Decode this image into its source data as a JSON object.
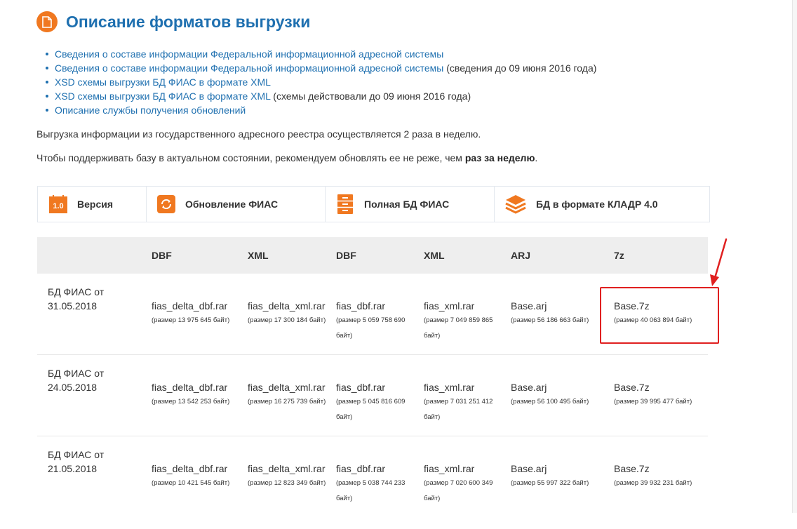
{
  "page": {
    "title": "Описание форматов выгрузки"
  },
  "links": [
    {
      "text": "Сведения о составе информации Федеральной информационной адресной системы",
      "note": ""
    },
    {
      "text": "Сведения о составе информации Федеральной информационной адресной системы",
      "note": " (сведения до 09 июня 2016 года)"
    },
    {
      "text": "XSD схемы выгрузки БД ФИАС в формате XML",
      "note": ""
    },
    {
      "text": "XSD схемы выгрузки БД ФИАС в формате XML",
      "note": " (схемы действовали до 09 июня 2016 года)"
    },
    {
      "text": "Описание службы получения обновлений",
      "note": ""
    }
  ],
  "paragraphs": {
    "schedule": "Выгрузка информации из государственного адресного реестра осуществляется 2 раза в неделю.",
    "recommend_prefix": "Чтобы поддерживать базу в актуальном состоянии, рекомендуем обновлять ее не реже, чем ",
    "recommend_bold": "раз за неделю",
    "recommend_suffix": "."
  },
  "tabs": [
    {
      "label": "Версия",
      "icon": "version-icon",
      "icon_text": "1.0"
    },
    {
      "label": "Обновление ФИАС",
      "icon": "refresh-icon"
    },
    {
      "label": "Полная БД ФИАС",
      "icon": "cabinet-icon"
    },
    {
      "label": "БД в формате КЛАДР 4.0",
      "icon": "layers-icon"
    }
  ],
  "table": {
    "columns": [
      "DBF",
      "XML",
      "DBF",
      "XML",
      "ARJ",
      "7z"
    ],
    "rows": [
      {
        "label": "БД ФИАС от 31.05.2018",
        "cells": [
          {
            "name": "fias_delta_dbf.rar",
            "size": "(размер 13 975 645 байт)"
          },
          {
            "name": "fias_delta_xml.rar",
            "size": "(размер 17 300 184 байт)"
          },
          {
            "name": "fias_dbf.rar",
            "size": "(размер 5 059 758 690 байт)"
          },
          {
            "name": "fias_xml.rar",
            "size": "(размер 7 049 859 865 байт)"
          },
          {
            "name": "Base.arj",
            "size": "(размер 56 186 663 байт)"
          },
          {
            "name": "Base.7z",
            "size": "(размер 40 063 894 байт)"
          }
        ]
      },
      {
        "label": "БД ФИАС от 24.05.2018",
        "cells": [
          {
            "name": "fias_delta_dbf.rar",
            "size": "(размер 13 542 253 байт)"
          },
          {
            "name": "fias_delta_xml.rar",
            "size": "(размер 16 275 739 байт)"
          },
          {
            "name": "fias_dbf.rar",
            "size": "(размер 5 045 816 609 байт)"
          },
          {
            "name": "fias_xml.rar",
            "size": "(размер 7 031 251 412 байт)"
          },
          {
            "name": "Base.arj",
            "size": "(размер 56 100 495 байт)"
          },
          {
            "name": "Base.7z",
            "size": "(размер 39 995 477 байт)"
          }
        ]
      },
      {
        "label": "БД ФИАС от 21.05.2018",
        "cells": [
          {
            "name": "fias_delta_dbf.rar",
            "size": "(размер 10 421 545 байт)"
          },
          {
            "name": "fias_delta_xml.rar",
            "size": "(размер 12 823 349 байт)"
          },
          {
            "name": "fias_dbf.rar",
            "size": "(размер 5 038 744 233 байт)"
          },
          {
            "name": "fias_xml.rar",
            "size": "(размер 7 020 600 349 байт)"
          },
          {
            "name": "Base.arj",
            "size": "(размер 55 997 322 байт)"
          },
          {
            "name": "Base.7z",
            "size": "(размер 39 932 231 байт)"
          }
        ]
      }
    ]
  },
  "colors": {
    "accent": "#f07820",
    "link": "#1f70b0",
    "highlight": "#e02020"
  }
}
